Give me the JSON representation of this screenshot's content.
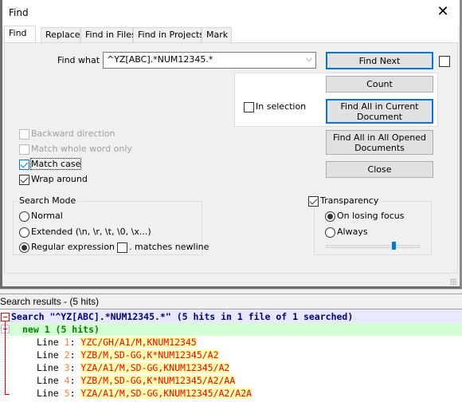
{
  "dialog": {
    "title": "Find",
    "tabs": [
      {
        "label": "Find",
        "active": true
      },
      {
        "label": "Replace",
        "active": false
      },
      {
        "label": "Find in Files",
        "active": false
      },
      {
        "label": "Find in Projects",
        "active": false
      },
      {
        "label": "Mark",
        "active": false
      }
    ],
    "find_what_label": "Find what :",
    "find_what_value": "^YZ[ABC].*NUM12345.*",
    "in_selection_label": "In selection",
    "buttons": {
      "find_next": "Find Next",
      "count": "Count",
      "find_all_current_line1": "Find All in Current",
      "find_all_current_line2": "Document",
      "find_all_opened_line1": "Find All in All Opened",
      "find_all_opened_line2": "Documents",
      "close": "Close"
    },
    "options": {
      "backward_direction": {
        "label": "Backward direction",
        "checked": false,
        "enabled": false
      },
      "match_whole_word": {
        "label": "Match whole word only",
        "checked": false,
        "enabled": false
      },
      "match_case": {
        "label": "Match case",
        "checked": true,
        "enabled": true
      },
      "wrap_around": {
        "label": "Wrap around",
        "checked": true,
        "enabled": true
      }
    },
    "search_mode": {
      "title": "Search Mode",
      "normal": "Normal",
      "extended": "Extended (\\n, \\r, \\t, \\0, \\x...)",
      "regex": "Regular expression",
      "selected": "regex",
      "dot_matches_newline": ". matches newline"
    },
    "transparency": {
      "label": "Transparency",
      "checked": true,
      "on_losing_focus": "On losing focus",
      "always": "Always",
      "selected": "on_losing_focus",
      "slider_value_percent": 72
    }
  },
  "results": {
    "header": "Search results - (5 hits)",
    "search_line": "Search \"^YZ[ABC].*NUM12345.*\" (5 hits in 1 file of 1 searched)",
    "file_line": "new 1 (5 hits)",
    "lines": [
      {
        "prefix": "Line ",
        "num": "1",
        "sep": ": ",
        "text": "YZC/GH/A1/M,KNUM12345"
      },
      {
        "prefix": "Line ",
        "num": "2",
        "sep": ": ",
        "text": "YZB/M,SD-GG,K*NUM12345/A2"
      },
      {
        "prefix": "Line ",
        "num": "3",
        "sep": ": ",
        "text": "YZA/A1/M,SD-GG,KNUM12345/A2"
      },
      {
        "prefix": "Line ",
        "num": "4",
        "sep": ": ",
        "text": "YZB/M,SD-GG,K*NUM12345/A2/AA"
      },
      {
        "prefix": "Line ",
        "num": "5",
        "sep": ": ",
        "text": "YZA/A1/M,SD-GG,KNUM12345/A2/A2A"
      }
    ]
  }
}
